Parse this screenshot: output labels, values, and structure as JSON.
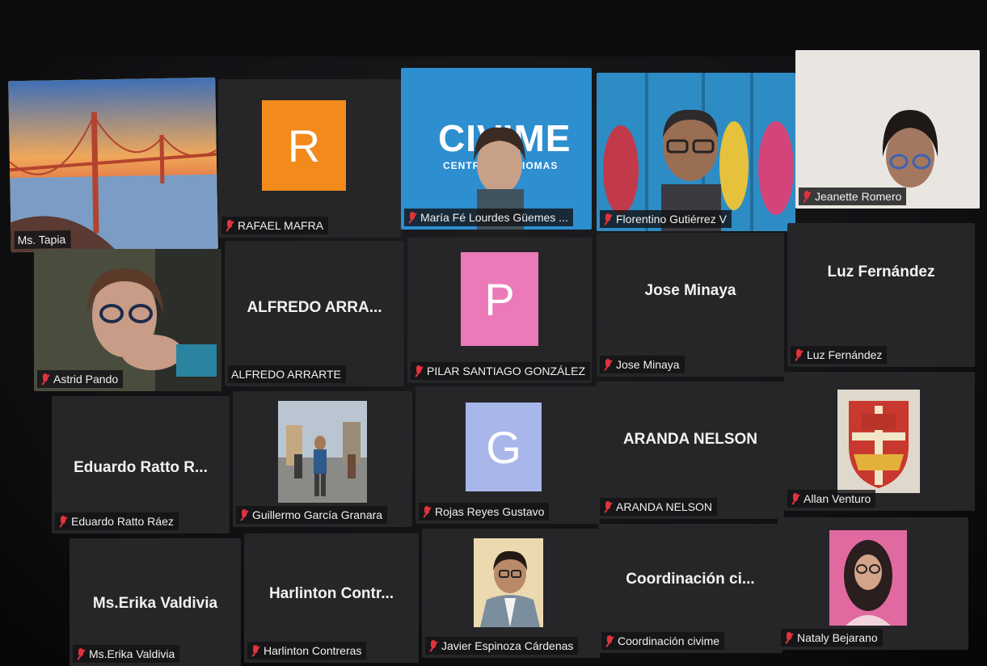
{
  "participants": [
    {
      "id": "ms-tapia",
      "display_name": "Ms. Tapia",
      "tile": "video-landscape",
      "active": true
    },
    {
      "id": "rafael-mafra",
      "display_name": "RAFAEL MAFRA",
      "tile": "avatar",
      "initial": "R",
      "avatar_color": "#f28a1c"
    },
    {
      "id": "maria-fe",
      "display_name": "María Fé Lourdes Güemes ...",
      "tile": "video",
      "banner_text": "CIVIME",
      "banner_subtext": "CENTRO DE IDIOMAS"
    },
    {
      "id": "florentino",
      "display_name": "Florentino Gutiérrez V",
      "tile": "video"
    },
    {
      "id": "jeanette",
      "display_name": "Jeanette Romero",
      "tile": "video"
    },
    {
      "id": "astrid",
      "display_name": "Astrid  Pando",
      "tile": "video"
    },
    {
      "id": "alfredo",
      "display_name": "ALFREDO ARRARTE",
      "center_name": "ALFREDO ARRA...",
      "tile": "name"
    },
    {
      "id": "pilar",
      "display_name": "PILAR SANTIAGO GONZÁLEZ",
      "tile": "avatar",
      "initial": "P",
      "avatar_color": "#ec79b8"
    },
    {
      "id": "jose",
      "display_name": "Jose Minaya",
      "center_name": "Jose Minaya",
      "tile": "name"
    },
    {
      "id": "luz",
      "display_name": "Luz Fernández",
      "center_name": "Luz Fernández",
      "tile": "name"
    },
    {
      "id": "eduardo",
      "display_name": "Eduardo Ratto Ráez",
      "center_name": "Eduardo Ratto R...",
      "tile": "name"
    },
    {
      "id": "guillermo",
      "display_name": "Guillermo García Granara",
      "tile": "photo"
    },
    {
      "id": "rojas",
      "display_name": "Rojas  Reyes Gustavo",
      "tile": "avatar",
      "initial": "G",
      "avatar_color": "#a9b6ea"
    },
    {
      "id": "aranda",
      "display_name": "ARANDA NELSON",
      "center_name": "ARANDA NELSON",
      "tile": "name"
    },
    {
      "id": "allan",
      "display_name": "Allan Venturo",
      "tile": "photo"
    },
    {
      "id": "erika",
      "display_name": "Ms.Erika Valdivia",
      "center_name": "Ms.Erika Valdivia",
      "tile": "name"
    },
    {
      "id": "harlinton",
      "display_name": "Harlinton Contreras",
      "center_name": "Harlinton  Contr...",
      "tile": "name"
    },
    {
      "id": "javier",
      "display_name": "Javier Espinoza Cárdenas",
      "tile": "photo"
    },
    {
      "id": "coordinacion",
      "display_name": "Coordinación civime",
      "center_name": "Coordinación  ci...",
      "tile": "name"
    },
    {
      "id": "nataly",
      "display_name": "Nataly Bejarano",
      "tile": "photo"
    }
  ],
  "colors": {
    "active_speaker_border": "#c8d62e",
    "muted_icon": "#e0333c",
    "tile_background": "#262629"
  },
  "icons": {
    "muted": "mic-off-icon"
  }
}
